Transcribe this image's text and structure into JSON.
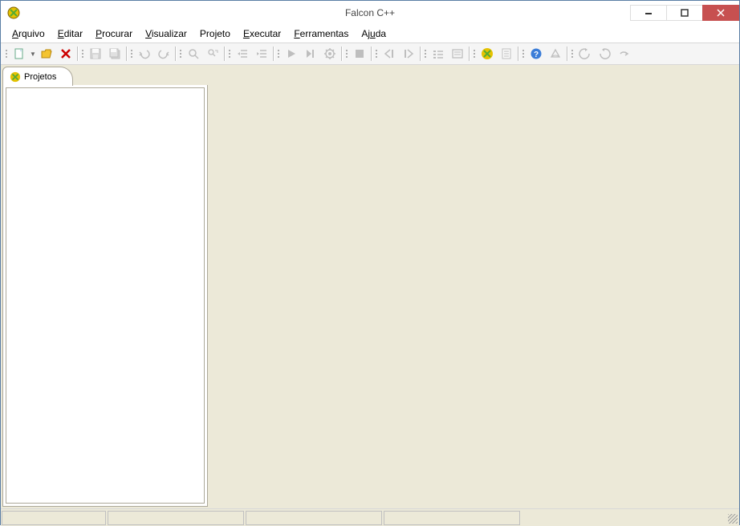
{
  "window": {
    "title": "Falcon C++"
  },
  "menu": {
    "arquivo": "Arquivo",
    "editar": "Editar",
    "procurar": "Procurar",
    "visualizar": "Visualizar",
    "projeto": "Projeto",
    "executar": "Executar",
    "ferramentas": "Ferramentas",
    "ajuda": "Ajuda"
  },
  "sidebar": {
    "tab": "Projetos"
  },
  "icons": {
    "new": "new",
    "open": "open",
    "remove": "remove",
    "save": "save",
    "saveall": "saveall",
    "undo": "undo",
    "redo": "redo",
    "find": "find",
    "replace": "replace",
    "outdent": "outdent",
    "indent": "indent",
    "run": "run",
    "runto": "runto",
    "build": "build",
    "stop": "stop",
    "stepout": "stepout",
    "stepin": "stepin",
    "breakpoints": "breakpoints",
    "watch": "watch",
    "app": "app",
    "props": "props",
    "help": "help",
    "book": "book",
    "prev": "prev",
    "next": "next",
    "up": "up"
  }
}
